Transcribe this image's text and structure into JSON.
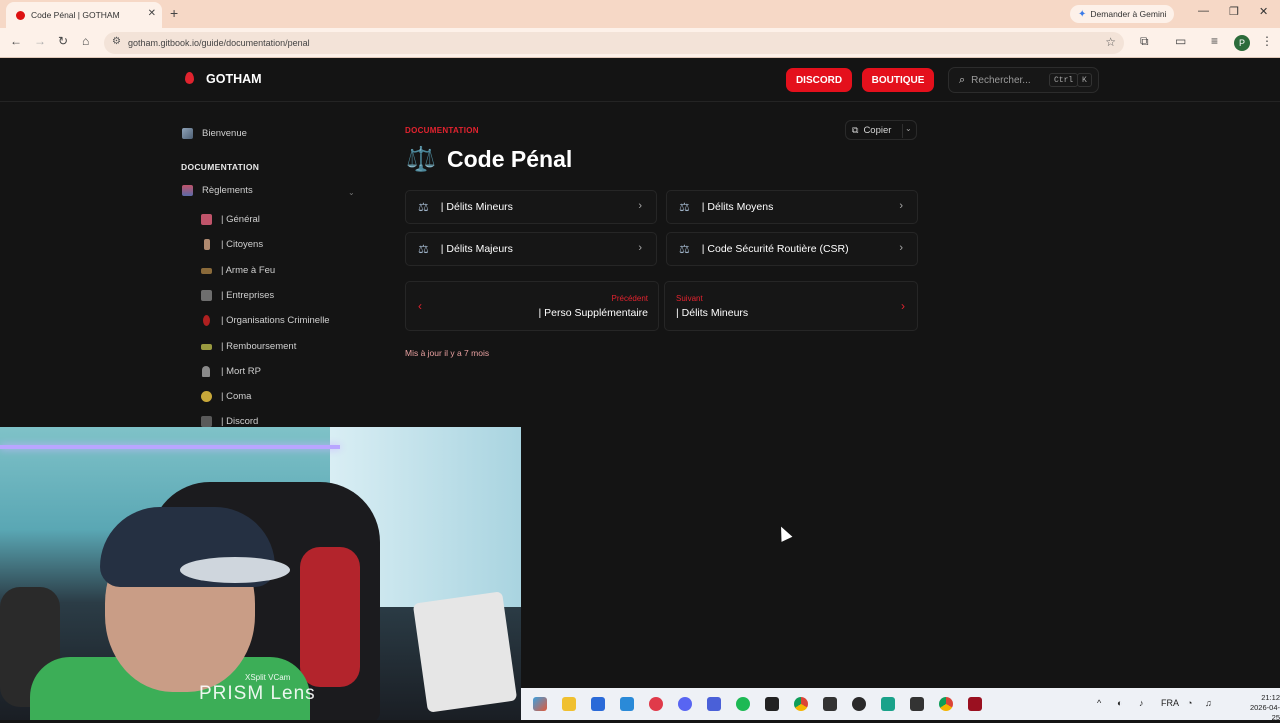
{
  "browser": {
    "tab_title": "Code Pénal | GOTHAM",
    "tab_close": "✕",
    "new_tab": "+",
    "gemini_label": "Demander à Gemini",
    "url": "gotham.gitbook.io/guide/documentation/penal",
    "profile_initial": "P",
    "window_controls": [
      "—",
      "❐",
      "✕"
    ]
  },
  "header": {
    "brand": "GOTHAM",
    "discord": "DISCORD",
    "boutique": "BOUTIQUE",
    "search_placeholder": "Rechercher...",
    "kbd_ctrl": "Ctrl",
    "kbd_k": "K"
  },
  "sidebar": {
    "welcome": "Bienvenue",
    "section": "DOCUMENTATION",
    "group": "Règlements",
    "items": [
      {
        "label": "| Général",
        "color": "#c0546a"
      },
      {
        "label": "| Citoyens",
        "color": "#b08a70"
      },
      {
        "label": "| Arme à Feu",
        "color": "#8a6a3a"
      },
      {
        "label": "| Entreprises",
        "color": "#7a7a7a"
      },
      {
        "label": "| Organisations Criminelle",
        "color": "#b02020"
      },
      {
        "label": "| Remboursement",
        "color": "#9a9a40"
      },
      {
        "label": "| Mort RP",
        "color": "#9a9a9a"
      },
      {
        "label": "| Coma",
        "color": "#d0b040"
      },
      {
        "label": "| Discord",
        "color": "#6a6a6a"
      }
    ]
  },
  "main": {
    "breadcrumb": "DOCUMENTATION",
    "copy": "Copier",
    "title_icon": "⚖️",
    "title": "Code Pénal",
    "cards": [
      {
        "label": "| Délits Mineurs"
      },
      {
        "label": "| Délits Moyens"
      },
      {
        "label": "| Délits Majeurs"
      },
      {
        "label": "| Code Sécurité Routière (CSR)"
      }
    ],
    "prev_label": "Précédent",
    "prev_title": "| Perso Supplémentaire",
    "next_label": "Suivant",
    "next_title": "| Délits Mineurs",
    "updated": "Mis à jour il y a 7 mois"
  },
  "webcam": {
    "watermark_small": "XSplit VCam",
    "watermark_big": "PRISM Lens"
  },
  "taskbar": {
    "lang": "FRA",
    "time": "21:12",
    "date": "2026-04-25"
  }
}
